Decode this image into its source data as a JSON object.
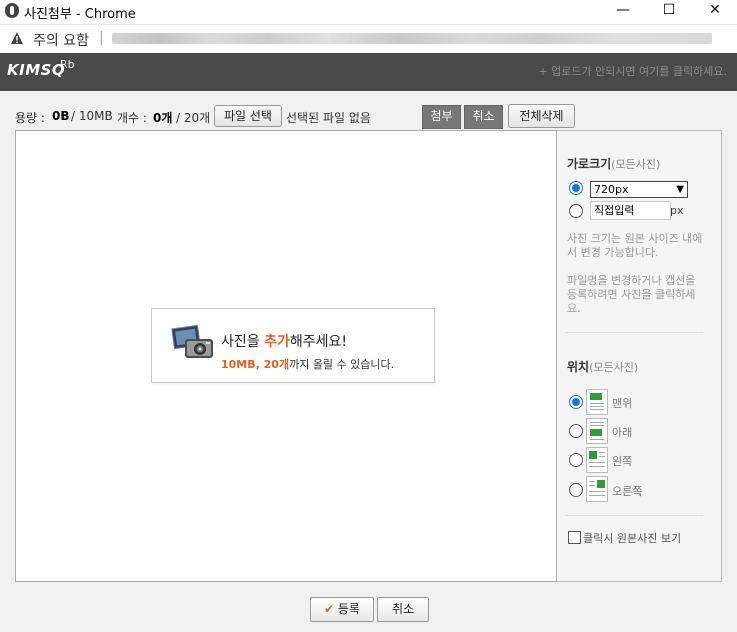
{
  "window": {
    "title": "사진첨부 - Chrome",
    "minimize_glyph": "—",
    "maximize_glyph": "☐",
    "close_glyph": "✕"
  },
  "addressbar": {
    "warning_text": "주의 요함",
    "separator": "|"
  },
  "header": {
    "logo_text": "KIMSQ",
    "logo_sup": "Rb",
    "hint": "+ 업로드가 안되시면 여기를 클릭하세요."
  },
  "toolbar": {
    "capacity_label": "용량 :",
    "capacity_value": "0B",
    "capacity_max": "/ 10MB",
    "count_label": "개수 :",
    "count_value": "0개",
    "count_max": "/ 20개",
    "choose_file_button": "파일 선택",
    "no_file_text": "선택된 파일 없음",
    "attach_button": "첨부",
    "cancel_button": "취소",
    "delete_all_button": "전체삭제"
  },
  "empty_state": {
    "title_pre": "사진을 ",
    "title_accent": "추가",
    "title_post": "해주세요!",
    "sub_accent": "10MB, 20개",
    "sub_post": "까지 올릴 수 있습니다."
  },
  "sidebar": {
    "width_title": "가로크기",
    "width_title_sub": "(모든사진)",
    "width_selected": "720px",
    "custom_input_value": "직접입력",
    "px_unit": "px",
    "note1": "사진 크기는 원본 사이즈 내에서 변경 가능합니다.",
    "note2": "파일명을 변경하거나 캡션을 등록하려면 사진을 클릭하세요.",
    "position_title": "위치",
    "position_title_sub": "(모든사진)",
    "positions": [
      {
        "label": "맨위",
        "selected": true
      },
      {
        "label": "아래",
        "selected": false
      },
      {
        "label": "왼쪽",
        "selected": false
      },
      {
        "label": "오른쪽",
        "selected": false
      }
    ],
    "original_view_label": "클릭시 원본사진 보기"
  },
  "footer": {
    "submit_label": "등록",
    "submit_icon": "✔",
    "cancel_label": "취소"
  },
  "colors": {
    "accent": "#e8601a",
    "header_bg": "#4a4a4a",
    "radio_selected": "#1a73e8"
  }
}
